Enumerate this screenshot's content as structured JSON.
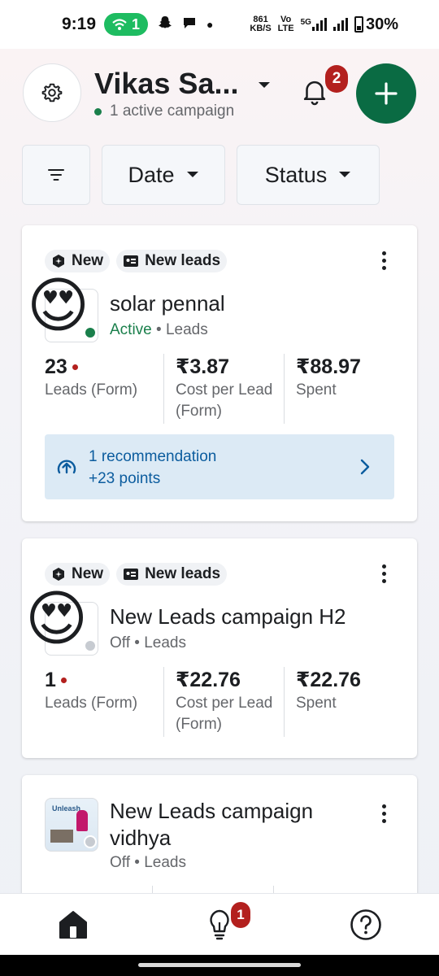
{
  "status_bar": {
    "time": "9:19",
    "hotspot_count": "1",
    "net_speed_top": "861",
    "net_speed_bottom": "KB/S",
    "volte_top": "Vo",
    "volte_bottom": "LTE",
    "network": "5G",
    "battery": "30%"
  },
  "header": {
    "account_name": "Vikas Sa...",
    "campaign_status": "1 active campaign",
    "notification_count": "2"
  },
  "filters": {
    "date_label": "Date",
    "status_label": "Status"
  },
  "campaigns": [
    {
      "badge_new": "New",
      "badge_objective": "New leads",
      "name": "solar pennal",
      "status": "Active",
      "separator": "•",
      "objective": "Leads",
      "metrics": [
        {
          "value": "23",
          "label": "Leads (Form)"
        },
        {
          "value": "₹3.87",
          "label": "Cost per Lead (Form)"
        },
        {
          "value": "₹88.97",
          "label": "Spent"
        }
      ],
      "recommendation_line1": "1 recommendation",
      "recommendation_line2": "+23 points"
    },
    {
      "badge_new": "New",
      "badge_objective": "New leads",
      "name": "New Leads campaign H2",
      "status": "Off",
      "separator": "•",
      "objective": "Leads",
      "metrics": [
        {
          "value": "1",
          "label": "Leads (Form)"
        },
        {
          "value": "₹22.76",
          "label": "Cost per Lead (Form)"
        },
        {
          "value": "₹22.76",
          "label": "Spent"
        }
      ]
    },
    {
      "name": "New Leads campaign vidhya",
      "status": "Off",
      "separator": "•",
      "objective": "Leads",
      "thumbnail_text": "Unleash"
    }
  ],
  "bottom_nav": {
    "tips_badge": "1"
  },
  "colors": {
    "brand_green": "#0a6b43",
    "active_green": "#1a7f4b",
    "badge_red": "#b3201e",
    "reco_blue": "#0b5c9e",
    "reco_bg": "#dceaf5"
  },
  "icons": [
    "gear-icon",
    "chevron-down-icon",
    "bell-icon",
    "plus-icon",
    "filter-icon",
    "hexagon-icon",
    "id-card-icon",
    "more-vertical-icon",
    "heart-eyes-emoji",
    "arrow-up-circle-icon",
    "chevron-right-icon",
    "home-icon",
    "lightbulb-icon",
    "help-icon"
  ]
}
